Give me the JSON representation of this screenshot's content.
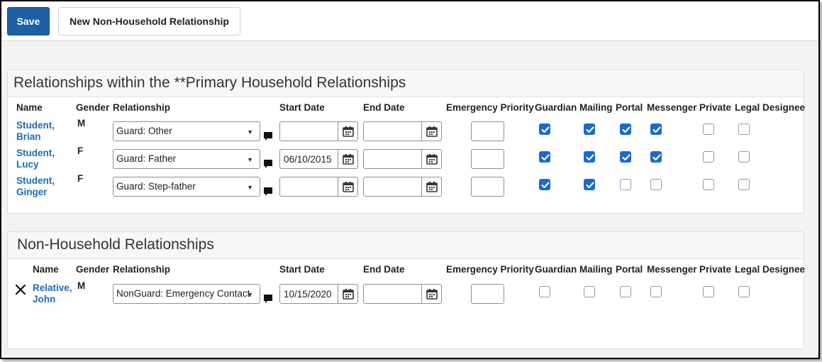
{
  "toolbar": {
    "save_label": "Save",
    "new_label": "New Non-Household Relationship"
  },
  "columns": {
    "name": "Name",
    "gender": "Gender",
    "relationship": "Relationship",
    "start_date": "Start Date",
    "end_date": "End Date",
    "emergency_priority": "Emergency Priority",
    "guardian": "Guardian",
    "mailing": "Mailing",
    "portal": "Portal",
    "messenger": "Messenger",
    "private": "Private",
    "legal_designee": "Legal Designee"
  },
  "primary": {
    "title": "Relationships within the **Primary Household Relationships",
    "rows": [
      {
        "last": "Student,",
        "first": "Brian",
        "gender": "M",
        "relationship": "Guard: Other",
        "start_date": "",
        "end_date": "",
        "emergency_priority": "",
        "guardian": true,
        "mailing": true,
        "portal": true,
        "messenger": true,
        "private": false,
        "legal_designee": false
      },
      {
        "last": "Student,",
        "first": "Lucy",
        "gender": "F",
        "relationship": "Guard: Father",
        "start_date": "06/10/2015",
        "end_date": "",
        "emergency_priority": "",
        "guardian": true,
        "mailing": true,
        "portal": true,
        "messenger": true,
        "private": false,
        "legal_designee": false
      },
      {
        "last": "Student,",
        "first": "Ginger",
        "gender": "F",
        "relationship": "Guard: Step-father",
        "start_date": "",
        "end_date": "",
        "emergency_priority": "",
        "guardian": true,
        "mailing": true,
        "portal": false,
        "messenger": false,
        "private": false,
        "legal_designee": false
      }
    ]
  },
  "non_household": {
    "title": "Non-Household Relationships",
    "rows": [
      {
        "last": "Relative,",
        "first": "John",
        "gender": "M",
        "relationship": "NonGuard: Emergency Contact",
        "start_date": "10/15/2020",
        "end_date": "",
        "emergency_priority": "",
        "guardian": false,
        "mailing": false,
        "portal": false,
        "messenger": false,
        "private": false,
        "legal_designee": false
      }
    ]
  },
  "icons": {
    "comment": "comment-icon",
    "calendar": "calendar-icon",
    "delete": "delete-x-icon",
    "dropdown": "chevron-down-icon"
  },
  "colors": {
    "accent": "#1b5fa5",
    "link": "#1b6db6",
    "checkbox_checked": "#1a6ad4"
  }
}
